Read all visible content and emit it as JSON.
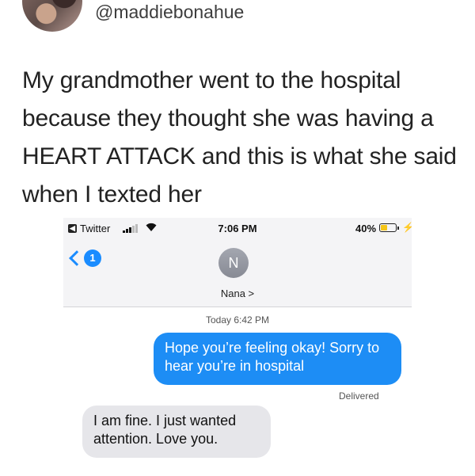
{
  "tweet": {
    "handle": "@maddiebonahue",
    "text": "My grandmother went to the hospital because they thought she was having a HEART ATTACK and this is what she said when I texted her"
  },
  "phone": {
    "status_bar": {
      "back_app": "Twitter",
      "time": "7:06 PM",
      "battery": "40%",
      "battery_level": 0.4
    },
    "nav": {
      "back_count": "1",
      "contact_initial": "N",
      "contact_name": "Nana >"
    },
    "thread": {
      "timestamp": "Today 6:42 PM",
      "outgoing": "Hope you’re feeling okay! Sorry to hear you’re in hospital",
      "delivered": "Delivered",
      "incoming": "I am fine. I just wanted attention. Love you."
    }
  },
  "colors": {
    "imessage_blue": "#1d8df5",
    "incoming_gray": "#e6e6ea",
    "battery_yellow": "#f5c518"
  }
}
